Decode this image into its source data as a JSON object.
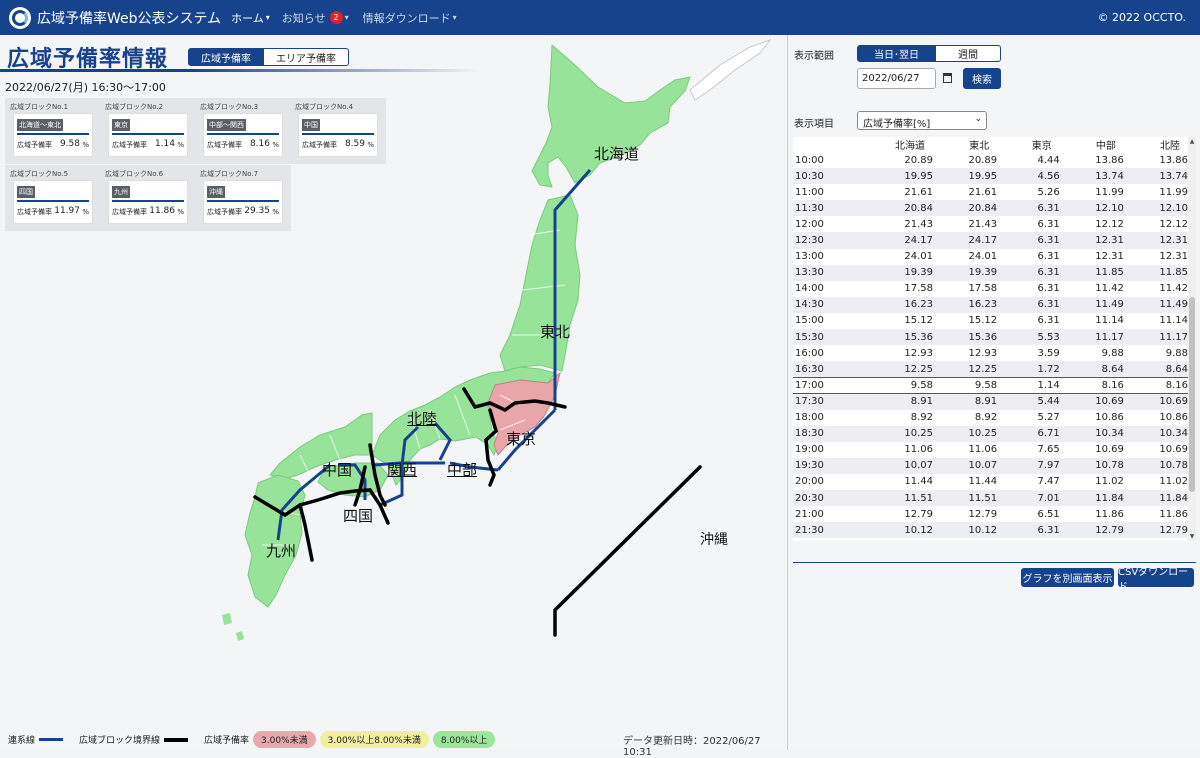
{
  "nav": {
    "brand": "広域予備率Web公表システム",
    "items": [
      {
        "label": "ホーム",
        "caret": "▾"
      },
      {
        "label": "お知らせ",
        "badge": "2",
        "caret": "▾"
      },
      {
        "label": "情報ダウンロード",
        "caret": "▾"
      }
    ],
    "copyright": "© 2022 OCCTO."
  },
  "page": {
    "title": "広域予備率情報",
    "tabs": [
      "広域予備率",
      "エリア予備率"
    ],
    "datetime": "2022/06/27(月) 16:30～17:00"
  },
  "blocks": [
    {
      "no": "広域ブロックNo.1",
      "name": "北海道～東北",
      "label": "広域予備率",
      "value": "9.58",
      "unit": "%"
    },
    {
      "no": "広域ブロックNo.2",
      "name": "東京",
      "label": "広域予備率",
      "value": "1.14",
      "unit": "%"
    },
    {
      "no": "広域ブロックNo.3",
      "name": "中部～関西",
      "label": "広域予備率",
      "value": "8.16",
      "unit": "%"
    },
    {
      "no": "広域ブロックNo.4",
      "name": "中国",
      "label": "広域予備率",
      "value": "8.59",
      "unit": "%"
    },
    {
      "no": "広域ブロックNo.5",
      "name": "四国",
      "label": "広域予備率",
      "value": "11.97",
      "unit": "%"
    },
    {
      "no": "広域ブロックNo.6",
      "name": "九州",
      "label": "広域予備率",
      "value": "11.86",
      "unit": "%"
    },
    {
      "no": "広域ブロックNo.7",
      "name": "沖縄",
      "label": "広域予備率",
      "value": "29.35",
      "unit": "%"
    }
  ],
  "map_labels": {
    "hokkaido": "北海道",
    "tohoku": "東北",
    "hokuriku": "北陸",
    "tokyo": "東京",
    "chubu": "中部",
    "kansai": "関西",
    "chugoku": "中国",
    "shikoku": "四国",
    "kyushu": "九州",
    "okinawa": "沖縄"
  },
  "legend": {
    "interconnect": "連系線",
    "boundary": "広域ブロック境界線",
    "rate": "広域予備率",
    "ranges": [
      {
        "label": "3.00%未満",
        "color": "#e8a9ad"
      },
      {
        "label": "3.00%以上8.00%未満",
        "color": "#f1ef9f"
      },
      {
        "label": "8.00%以上",
        "color": "#9be59c"
      }
    ],
    "update": "データ更新日時：2022/06/27 10:31"
  },
  "colors": {
    "brand": "#17438c",
    "land_ok": "#98e39a",
    "land_low": "#e8a6ab",
    "boundary": "#000000",
    "interconnect": "#17438c"
  },
  "right": {
    "range_label": "表示範囲",
    "range_tabs": [
      "当日･翌日",
      "週間"
    ],
    "date": "2022/06/27",
    "search": "検索",
    "item_label": "表示項目",
    "item_value": "広域予備率[%]",
    "columns": [
      "",
      "北海道",
      "東北",
      "東京",
      "中部",
      "北陸"
    ],
    "rows": [
      [
        "10:00",
        "20.89",
        "20.89",
        "4.44",
        "13.86",
        "13.86"
      ],
      [
        "10:30",
        "19.95",
        "19.95",
        "4.56",
        "13.74",
        "13.74"
      ],
      [
        "11:00",
        "21.61",
        "21.61",
        "5.26",
        "11.99",
        "11.99"
      ],
      [
        "11:30",
        "20.84",
        "20.84",
        "6.31",
        "12.10",
        "12.10"
      ],
      [
        "12:00",
        "21.43",
        "21.43",
        "6.31",
        "12.12",
        "12.12"
      ],
      [
        "12:30",
        "24.17",
        "24.17",
        "6.31",
        "12.31",
        "12.31"
      ],
      [
        "13:00",
        "24.01",
        "24.01",
        "6.31",
        "12.31",
        "12.31"
      ],
      [
        "13:30",
        "19.39",
        "19.39",
        "6.31",
        "11.85",
        "11.85"
      ],
      [
        "14:00",
        "17.58",
        "17.58",
        "6.31",
        "11.42",
        "11.42"
      ],
      [
        "14:30",
        "16.23",
        "16.23",
        "6.31",
        "11.49",
        "11.49"
      ],
      [
        "15:00",
        "15.12",
        "15.12",
        "6.31",
        "11.14",
        "11.14"
      ],
      [
        "15:30",
        "15.36",
        "15.36",
        "5.53",
        "11.17",
        "11.17"
      ],
      [
        "16:00",
        "12.93",
        "12.93",
        "3.59",
        "9.88",
        "9.88"
      ],
      [
        "16:30",
        "12.25",
        "12.25",
        "1.72",
        "8.64",
        "8.64"
      ],
      [
        "17:00",
        "9.58",
        "9.58",
        "1.14",
        "8.16",
        "8.16"
      ],
      [
        "17:30",
        "8.91",
        "8.91",
        "5.44",
        "10.69",
        "10.69"
      ],
      [
        "18:00",
        "8.92",
        "8.92",
        "5.27",
        "10.86",
        "10.86"
      ],
      [
        "18:30",
        "10.25",
        "10.25",
        "6.71",
        "10.34",
        "10.34"
      ],
      [
        "19:00",
        "11.06",
        "11.06",
        "7.65",
        "10.69",
        "10.69"
      ],
      [
        "19:30",
        "10.07",
        "10.07",
        "7.97",
        "10.78",
        "10.78"
      ],
      [
        "20:00",
        "11.44",
        "11.44",
        "7.47",
        "11.02",
        "11.02"
      ],
      [
        "20:30",
        "11.51",
        "11.51",
        "7.01",
        "11.84",
        "11.84"
      ],
      [
        "21:00",
        "12.79",
        "12.79",
        "6.51",
        "11.86",
        "11.86"
      ],
      [
        "21:30",
        "10.12",
        "10.12",
        "6.31",
        "12.79",
        "12.79"
      ]
    ],
    "current_row": "17:00",
    "buttons": [
      "グラフを別画面表示",
      "CSVダウンロード"
    ]
  }
}
